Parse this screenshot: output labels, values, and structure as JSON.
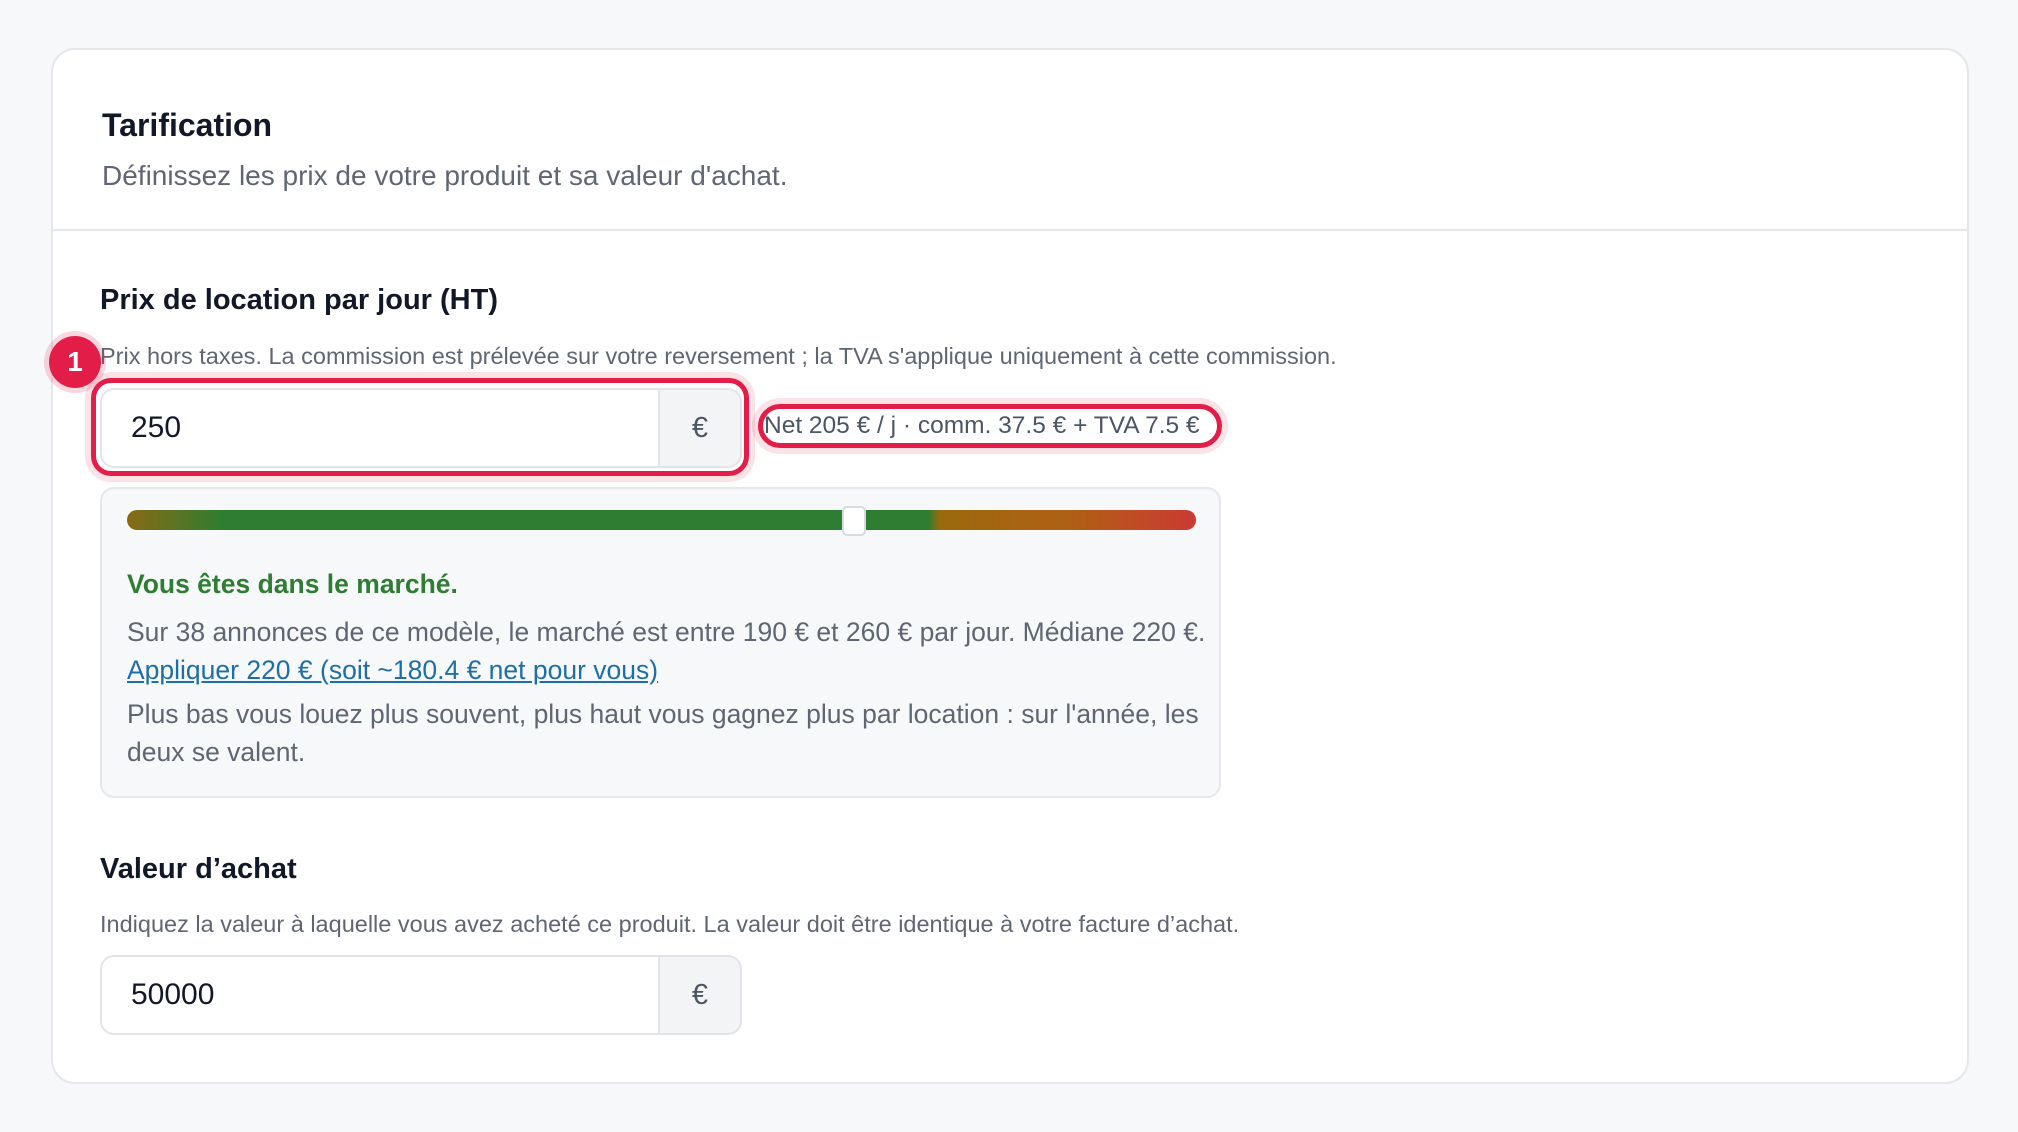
{
  "header": {
    "title": "Tarification",
    "subtitle": "Définissez les prix de votre produit et sa valeur d'achat."
  },
  "rental_price": {
    "label": "Prix de location par jour (HT)",
    "hint": "Prix hors taxes. La commission est prélevée sur votre reversement ; la TVA s'applique uniquement à cette commission.",
    "value": "250",
    "currency": "€",
    "net_summary": "Net 205 € / j · comm. 37.5 € + TVA 7.5 €",
    "annotation_badge": "1"
  },
  "market": {
    "status": "Vous êtes dans le marché.",
    "summary": "Sur 38 annonces de ce modèle, le marché est entre 190 € et 260 € par jour. Médiane 220 €.",
    "apply_link": "Appliquer 220 € (soit ~180.4 € net pour vous)",
    "advice": "Plus bas vous louez plus souvent, plus haut vous gagnez plus par location : sur l'année, les deux se valent.",
    "position_fraction": 0.68,
    "colors": {
      "low": "#8a6a14",
      "in_market": "#2e7d32",
      "high": "#cc3a34"
    }
  },
  "purchase_value": {
    "label": "Valeur d’achat",
    "hint": "Indiquez la valeur à laquelle vous avez acheté ce produit. La valeur doit être identique à votre facture d’achat.",
    "value": "50000",
    "currency": "€"
  },
  "colors": {
    "accent_highlight": "#e11d48",
    "link": "#1d6fa5",
    "success": "#2e7d32"
  }
}
